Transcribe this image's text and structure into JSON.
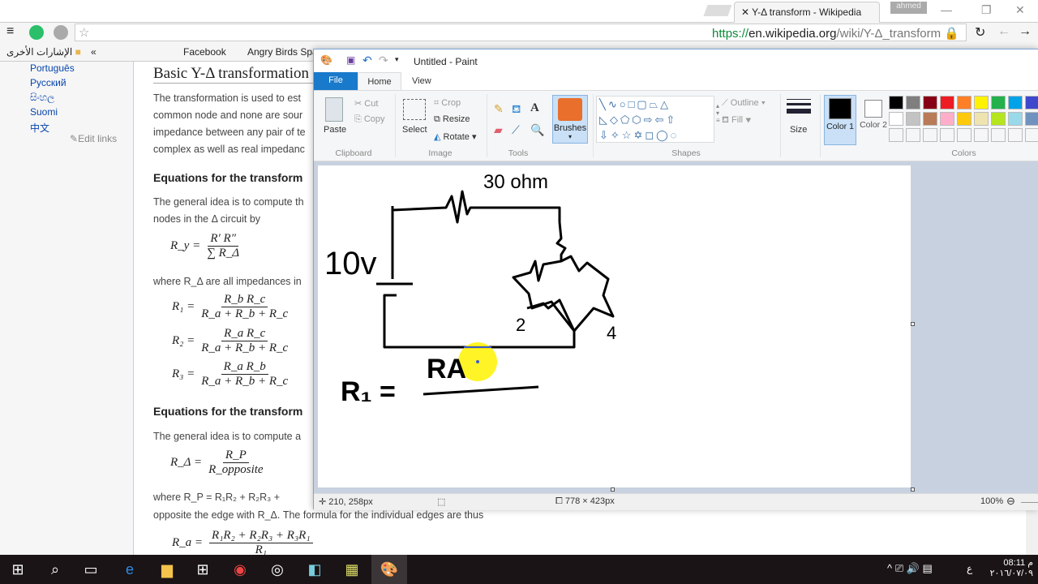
{
  "browser": {
    "tab_title": "Y-Δ transform - Wikipedia",
    "tab_favicon": "W",
    "user": "ahmed",
    "url_scheme": "https://",
    "url_host": "en.wikipedia.org",
    "url_path": "/wiki/Y-Δ_transform",
    "bookmarks": [
      "Facebook",
      "Angry Birds Spa"
    ],
    "other_bookmarks": "الإشارات الأخرى",
    "chevron": "«"
  },
  "wiki": {
    "languages": [
      "Português",
      "Русский",
      "සිංහල",
      "Suomi",
      "中文"
    ],
    "edit_links": "Edit links",
    "h2": "Basic Y-Δ transformation",
    "p1": [
      "The transformation is used to est",
      "common node and none are sour",
      "impedance between any pair of te",
      "complex as well as real impedanc"
    ],
    "h3a": "Equations for the transform",
    "p2": [
      "The general idea is to compute th",
      "nodes in the Δ circuit by"
    ],
    "eq_ry": {
      "lhs": "R_y =",
      "num": "R′ R″",
      "den": "∑ R_Δ"
    },
    "where1": "where R_Δ are all impedances in",
    "eqs": [
      {
        "lhs": "R₁ =",
        "num": "R_b R_c",
        "den": "R_a + R_b + R_c"
      },
      {
        "lhs": "R₂ =",
        "num": "R_a R_c",
        "den": "R_a + R_b + R_c"
      },
      {
        "lhs": "R₃ =",
        "num": "R_a R_b",
        "den": "R_a + R_b + R_c"
      }
    ],
    "h3b": "Equations for the transform",
    "p3": "The general idea is to compute a",
    "eq_rd": {
      "lhs": "R_Δ =",
      "num": "R_P",
      "den": "R_opposite"
    },
    "where2": "where R_P = R₁R₂ + R₂R₃ +",
    "p4": "opposite the edge with R_Δ. The formula for the individual edges are thus",
    "eq_ra": {
      "lhs": "R_a =",
      "num": "R₁R₂ + R₂R₃ + R₃R₁",
      "den": "R₁"
    }
  },
  "paint": {
    "title": "Untitled - Paint",
    "tabs": {
      "file": "File",
      "home": "Home",
      "view": "View"
    },
    "clipboard": {
      "paste": "Paste",
      "cut": "Cut",
      "copy": "Copy",
      "group": "Clipboard"
    },
    "image": {
      "select": "Select",
      "crop": "Crop",
      "resize": "Resize",
      "rotate": "Rotate",
      "group": "Image"
    },
    "tools": {
      "group": "Tools"
    },
    "brushes": "Brushes",
    "shapes": {
      "outline": "Outline",
      "fill": "Fill",
      "group": "Shapes"
    },
    "size": "Size",
    "color1": "Color 1",
    "color2": "Color 2",
    "colors_group": "Colors",
    "palette_row1": [
      "#000000",
      "#7f7f7f",
      "#880015",
      "#ed1c24",
      "#ff7f27",
      "#fff200",
      "#22b14c",
      "#00a2e8",
      "#3f48cc"
    ],
    "palette_row2": [
      "#ffffff",
      "#c3c3c3",
      "#b97a57",
      "#ffaec9",
      "#ffc90e",
      "#efe4b0",
      "#b5e61d",
      "#99d9ea",
      "#7092be"
    ],
    "color1_value": "#000000",
    "color2_value": "#ffffff",
    "status": {
      "cursor": "210, 258px",
      "size": "778 × 423px",
      "zoom": "100%"
    },
    "drawing": {
      "resistor_label": "30 ohm",
      "voltage_label": "10v",
      "node2": "2",
      "node4": "4",
      "formula_lhs": "R₁ =",
      "formula_num": "RA"
    }
  },
  "taskbar": {
    "time": "08:11 م",
    "date": "٢٠١٦/٠٧/٠٩",
    "lang": "ع"
  }
}
